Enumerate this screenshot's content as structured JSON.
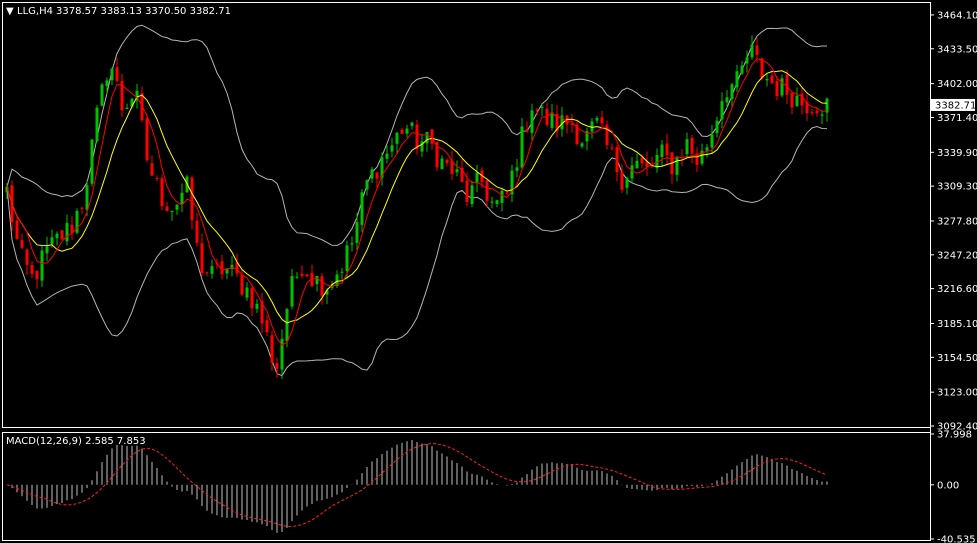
{
  "header": {
    "menu_arrow": "▼",
    "symbol": "LLG,H4",
    "ohlc": "3378.57 3383.13 3370.50 3382.71"
  },
  "price_axis": {
    "ticks": [
      "3464.10",
      "3433.50",
      "3402.00",
      "3371.40",
      "3339.90",
      "3309.30",
      "3277.80",
      "3247.20",
      "3216.60",
      "3185.10",
      "3154.50",
      "3123.00",
      "3092.40"
    ],
    "current_price": "3382.71"
  },
  "macd": {
    "label": "MACD(12,26,9) 2.585 7.853",
    "ticks": [
      "37.998",
      "0.00",
      "-40.535"
    ]
  },
  "colors": {
    "background": "#000000",
    "bull_candle": "#00c000",
    "bear_candle": "#ff0000",
    "bollinger": "#b4b4b4",
    "ma_fast": "#ff0000",
    "ma_slow": "#ffff00",
    "macd_hist": "#c0c0c0",
    "macd_signal": "#ff2020",
    "grid_border": "#ffffff"
  },
  "chart_data": [
    {
      "type": "candlestick",
      "symbol": "LLG",
      "timeframe": "H4",
      "ylim": [
        3092.4,
        3474.0
      ],
      "price_path": [
        3305,
        3245,
        3225,
        3248,
        3262,
        3272,
        3300,
        3370,
        3425,
        3380,
        3395,
        3330,
        3300,
        3290,
        3310,
        3240,
        3228,
        3236,
        3225,
        3212,
        3185,
        3142,
        3210,
        3240,
        3225,
        3220,
        3235,
        3260,
        3310,
        3330,
        3345,
        3365,
        3350,
        3348,
        3330,
        3320,
        3298,
        3315,
        3290,
        3300,
        3345,
        3385,
        3370,
        3365,
        3368,
        3350,
        3365,
        3340,
        3318,
        3330,
        3322,
        3338,
        3328,
        3349,
        3330,
        3358,
        3398,
        3402,
        3433,
        3410,
        3400,
        3395,
        3385,
        3385,
        3382
      ],
      "indicators": [
        "Bollinger Bands",
        "Moving Average (fast)",
        "Moving Average (slow)"
      ]
    },
    {
      "type": "histogram",
      "name": "MACD(12,26,9)",
      "ylim": [
        -40.535,
        37.998
      ],
      "series": [
        "macd_histogram",
        "signal_line"
      ]
    }
  ]
}
